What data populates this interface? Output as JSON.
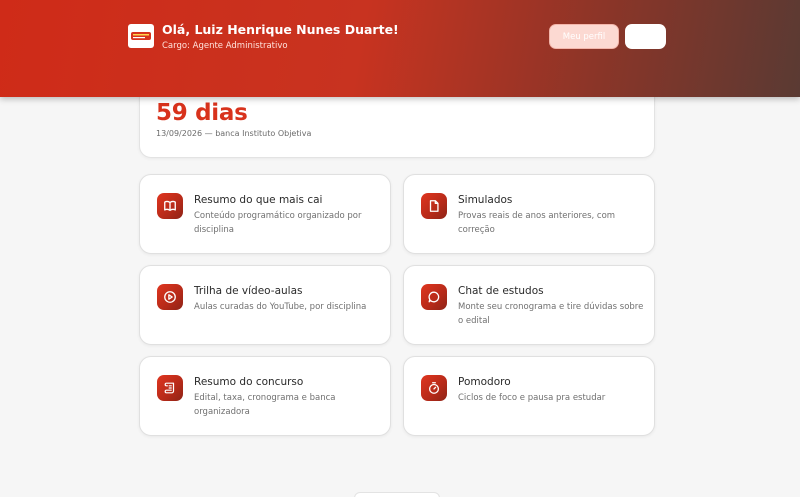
{
  "header": {
    "greeting": "Olá, Luiz Henrique Nunes Duarte!",
    "role": "Cargo: Agente Administrativo",
    "profile_button": "Meu perfil",
    "logo_icon": "brand-logo"
  },
  "countdown": {
    "days": "59 dias",
    "info": "13/09/2026 — banca Instituto Objetiva"
  },
  "cards": [
    {
      "title": "Resumo do que mais cai",
      "description": "Conteúdo programático organizado por disciplina",
      "icon": "book-icon"
    },
    {
      "title": "Simulados",
      "description": "Provas reais de anos anteriores, com correção",
      "icon": "document-icon"
    },
    {
      "title": "Trilha de vídeo-aulas",
      "description": "Aulas curadas do YouTube, por disciplina",
      "icon": "play-icon"
    },
    {
      "title": "Chat de estudos",
      "description": "Monte seu cronograma e tire dúvidas sobre o edital",
      "icon": "chat-icon"
    },
    {
      "title": "Resumo do concurso",
      "description": "Edital, taxa, cronograma e banca organizadora",
      "icon": "scroll-icon"
    },
    {
      "title": "Pomodoro",
      "description": "Ciclos de foco e pausa pra estudar",
      "icon": "timer-icon"
    }
  ],
  "colors": {
    "accent": "#d8321c",
    "header_start": "#cf2b18",
    "header_end": "#5a3a33"
  }
}
